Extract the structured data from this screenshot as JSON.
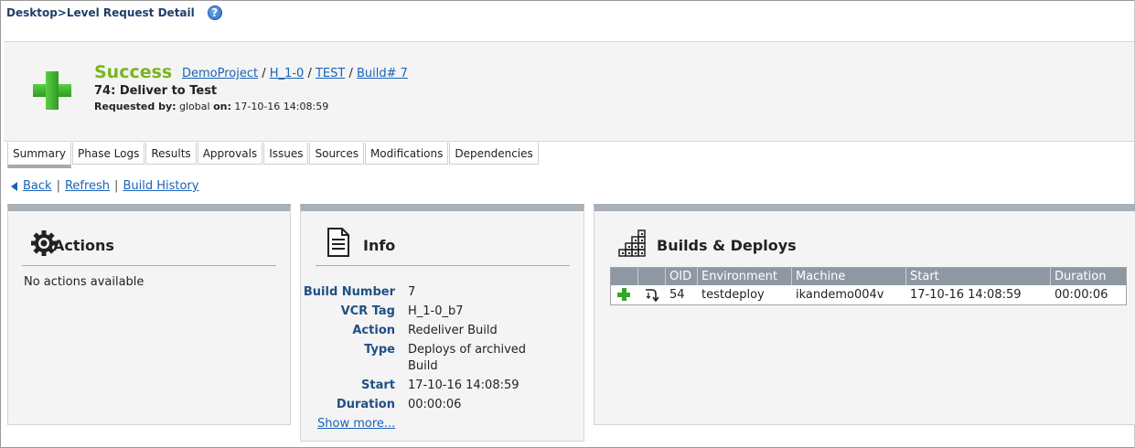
{
  "breadcrumb": "Desktop>Level Request Detail",
  "help_icon": "help-icon",
  "header": {
    "status": "Success",
    "status_color": "#7ab51d",
    "links": [
      "DemoProject",
      "H_1-0",
      "TEST",
      "Build# 7"
    ],
    "link_separator": "/",
    "title": "74: Deliver to Test",
    "requested_by_label": "Requested by:",
    "requested_by": "global",
    "on_label": "on:",
    "requested_on": "17-10-16 14:08:59"
  },
  "tabs": [
    "Summary",
    "Phase Logs",
    "Results",
    "Approvals",
    "Issues",
    "Sources",
    "Modifications",
    "Dependencies"
  ],
  "active_tab": "Summary",
  "nav": {
    "back": "Back",
    "refresh": "Refresh",
    "history": "Build History",
    "separator": "|"
  },
  "actions_panel": {
    "title": "Actions",
    "empty_text": "No actions available",
    "icon": "gear-icon"
  },
  "info_panel": {
    "title": "Info",
    "icon": "document-icon",
    "rows": [
      {
        "label": "Build Number",
        "value": "7"
      },
      {
        "label": "VCR Tag",
        "value": "H_1-0_b7"
      },
      {
        "label": "Action",
        "value": "Redeliver Build"
      },
      {
        "label": "Type",
        "value": "Deploys of archived Build"
      },
      {
        "label": "Start",
        "value": "17-10-16 14:08:59"
      },
      {
        "label": "Duration",
        "value": "00:00:06"
      }
    ],
    "show_more": "Show more..."
  },
  "builds_panel": {
    "title": "Builds & Deploys",
    "icon": "stairs-icon",
    "columns": [
      "",
      "",
      "OID",
      "Environment",
      "Machine",
      "Start",
      "Duration"
    ],
    "rows": [
      {
        "status_icon": "success-plus-icon",
        "action_icon": "redeliver-icon",
        "oid": "54",
        "environment": "testdeploy",
        "machine": "ikandemo004v",
        "start": "17-10-16 14:08:59",
        "duration": "00:00:06"
      }
    ]
  },
  "colors": {
    "link": "#1a63b8",
    "label": "#1f4f86",
    "grid_header": "#8e98a3",
    "panel_bar": "#a9afb6"
  }
}
